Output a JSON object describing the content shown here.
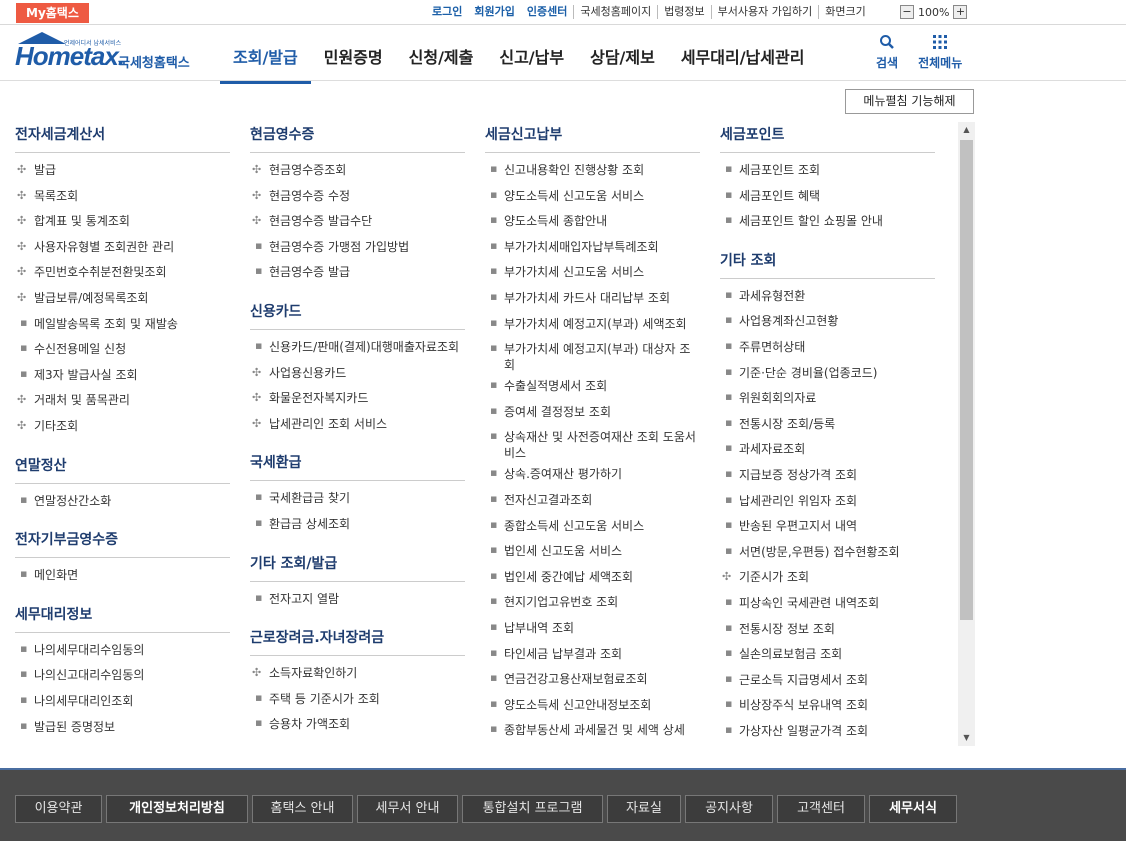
{
  "topbar": {
    "my_hometax": "My홈택스",
    "links": [
      "로그인",
      "회원가입",
      "인증센터",
      "국세청홈페이지",
      "법령정보",
      "부서사용자 가입하기"
    ],
    "zoom_label": "화면크기",
    "zoom_minus": "−",
    "zoom_value": "100%",
    "zoom_plus": "+"
  },
  "header": {
    "logo_small": "언제어디서 납세서비스",
    "logo_text": "Hometax.",
    "logo_kr": "국세청홈택스",
    "nav": [
      "조회/발급",
      "민원증명",
      "신청/제출",
      "신고/납부",
      "상담/제보",
      "세무대리/납세관리"
    ],
    "search_label": "검색",
    "allmenu_label": "전체메뉴"
  },
  "menu_release_label": "메뉴펼침 기능해제",
  "columns": [
    [
      {
        "title": "전자세금계산서",
        "items": [
          {
            "label": "발급",
            "type": "plus"
          },
          {
            "label": "목록조회",
            "type": "plus"
          },
          {
            "label": "합계표 및 통계조회",
            "type": "plus"
          },
          {
            "label": "사용자유형별 조회권한 관리",
            "type": "plus"
          },
          {
            "label": "주민번호수취분전환및조회",
            "type": "plus"
          },
          {
            "label": "발급보류/예정목록조회",
            "type": "plus"
          },
          {
            "label": "메일발송목록 조회 및 재발송",
            "type": "dot"
          },
          {
            "label": "수신전용메일 신청",
            "type": "dot"
          },
          {
            "label": "제3자 발급사실 조회",
            "type": "dot"
          },
          {
            "label": "거래처 및 품목관리",
            "type": "plus"
          },
          {
            "label": "기타조회",
            "type": "plus"
          }
        ]
      },
      {
        "title": "연말정산",
        "items": [
          {
            "label": "연말정산간소화",
            "type": "dot"
          }
        ]
      },
      {
        "title": "전자기부금영수증",
        "items": [
          {
            "label": "메인화면",
            "type": "dot"
          }
        ]
      },
      {
        "title": "세무대리정보",
        "items": [
          {
            "label": "나의세무대리수임동의",
            "type": "dot"
          },
          {
            "label": "나의신고대리수임동의",
            "type": "dot"
          },
          {
            "label": "나의세무대리인조회",
            "type": "dot"
          },
          {
            "label": "발급된 증명정보",
            "type": "dot"
          }
        ]
      }
    ],
    [
      {
        "title": "현금영수증",
        "items": [
          {
            "label": "현금영수증조회",
            "type": "plus"
          },
          {
            "label": "현금영수증 수정",
            "type": "plus"
          },
          {
            "label": "현금영수증 발급수단",
            "type": "plus"
          },
          {
            "label": "현금영수증 가맹점 가입방법",
            "type": "dot"
          },
          {
            "label": "현금영수증 발급",
            "type": "dot"
          }
        ]
      },
      {
        "title": "신용카드",
        "items": [
          {
            "label": "신용카드/판매(결제)대행매출자료조회",
            "type": "dot"
          },
          {
            "label": "사업용신용카드",
            "type": "plus"
          },
          {
            "label": "화물운전자복지카드",
            "type": "plus"
          },
          {
            "label": "납세관리인 조회 서비스",
            "type": "plus"
          }
        ]
      },
      {
        "title": "국세환급",
        "items": [
          {
            "label": "국세환급금 찾기",
            "type": "dot"
          },
          {
            "label": "환급금 상세조회",
            "type": "dot"
          }
        ]
      },
      {
        "title": "기타 조회/발급",
        "items": [
          {
            "label": "전자고지 열람",
            "type": "dot"
          }
        ]
      },
      {
        "title": "근로장려금.자녀장려금",
        "items": [
          {
            "label": "소득자료확인하기",
            "type": "plus"
          },
          {
            "label": "주택 등 기준시가 조회",
            "type": "dot"
          },
          {
            "label": "승용차 가액조회",
            "type": "dot"
          }
        ]
      }
    ],
    [
      {
        "title": "세금신고납부",
        "items": [
          {
            "label": "신고내용확인 진행상황 조회",
            "type": "dot"
          },
          {
            "label": "양도소득세 신고도움 서비스",
            "type": "dot"
          },
          {
            "label": "양도소득세 종합안내",
            "type": "dot"
          },
          {
            "label": "부가가치세매입자납부특례조회",
            "type": "dot"
          },
          {
            "label": "부가가치세 신고도움 서비스",
            "type": "dot"
          },
          {
            "label": "부가가치세 카드사 대리납부 조회",
            "type": "dot"
          },
          {
            "label": "부가가치세 예정고지(부과) 세액조회",
            "type": "dot"
          },
          {
            "label": "부가가치세 예정고지(부과) 대상자 조회",
            "type": "dot"
          },
          {
            "label": "수출실적명세서 조회",
            "type": "dot"
          },
          {
            "label": "증여세 결정정보 조회",
            "type": "dot"
          },
          {
            "label": "상속재산 및 사전증여재산 조회 도움서비스",
            "type": "dot"
          },
          {
            "label": "상속.증여재산 평가하기",
            "type": "dot"
          },
          {
            "label": "전자신고결과조회",
            "type": "dot"
          },
          {
            "label": "종합소득세 신고도움 서비스",
            "type": "dot"
          },
          {
            "label": "법인세 신고도움 서비스",
            "type": "dot"
          },
          {
            "label": "법인세 중간예납 세액조회",
            "type": "dot"
          },
          {
            "label": "현지기업고유번호 조회",
            "type": "dot"
          },
          {
            "label": "납부내역 조회",
            "type": "dot"
          },
          {
            "label": "타인세금 납부결과 조회",
            "type": "dot"
          },
          {
            "label": "연금건강고용산재보험료조회",
            "type": "dot"
          },
          {
            "label": "양도소득세 신고안내정보조회",
            "type": "dot"
          },
          {
            "label": "종합부동산세 과세물건 및 세액 상세",
            "type": "dot"
          }
        ]
      }
    ],
    [
      {
        "title": "세금포인트",
        "items": [
          {
            "label": "세금포인트 조회",
            "type": "dot"
          },
          {
            "label": "세금포인트 혜택",
            "type": "dot"
          },
          {
            "label": "세금포인트 할인 쇼핑몰 안내",
            "type": "dot"
          }
        ]
      },
      {
        "title": "기타 조회",
        "items": [
          {
            "label": "과세유형전환",
            "type": "dot"
          },
          {
            "label": "사업용계좌신고현황",
            "type": "dot"
          },
          {
            "label": "주류면허상태",
            "type": "dot"
          },
          {
            "label": "기준·단순 경비율(업종코드)",
            "type": "dot"
          },
          {
            "label": "위원회회의자료",
            "type": "dot"
          },
          {
            "label": "전통시장 조회/등록",
            "type": "dot"
          },
          {
            "label": "과세자료조회",
            "type": "dot"
          },
          {
            "label": "지급보증 정상가격 조회",
            "type": "dot"
          },
          {
            "label": "납세관리인 위임자 조회",
            "type": "dot"
          },
          {
            "label": "반송된 우편고지서 내역",
            "type": "dot"
          },
          {
            "label": "서면(방문,우편등) 접수현황조회",
            "type": "dot"
          },
          {
            "label": "기준시가 조회",
            "type": "plus"
          },
          {
            "label": "피상속인 국세관련 내역조회",
            "type": "dot"
          },
          {
            "label": "전통시장 정보 조회",
            "type": "dot"
          },
          {
            "label": "실손의료보험금 조회",
            "type": "dot"
          },
          {
            "label": "근로소득 지급명세서 조회",
            "type": "dot"
          },
          {
            "label": "비상장주식 보유내역 조회",
            "type": "dot"
          },
          {
            "label": "가상자산 일평균가격 조회",
            "type": "dot"
          }
        ]
      }
    ]
  ],
  "footer": {
    "nav": [
      "이용약관",
      "개인정보처리방침",
      "홈택스 안내",
      "세무서 안내",
      "통합설치 프로그램",
      "자료실",
      "공지사항",
      "고객센터",
      "세무서식"
    ],
    "highlight": [
      "개인정보처리방침",
      "세무서식"
    ]
  },
  "icons": {
    "plus": "✣",
    "dot": "▪",
    "search": "search-icon",
    "grid": "grid-icon"
  },
  "colors": {
    "brand": "#1f5ca8",
    "mytab": "#ee5a42",
    "footer_bg": "#4a4a4a"
  }
}
